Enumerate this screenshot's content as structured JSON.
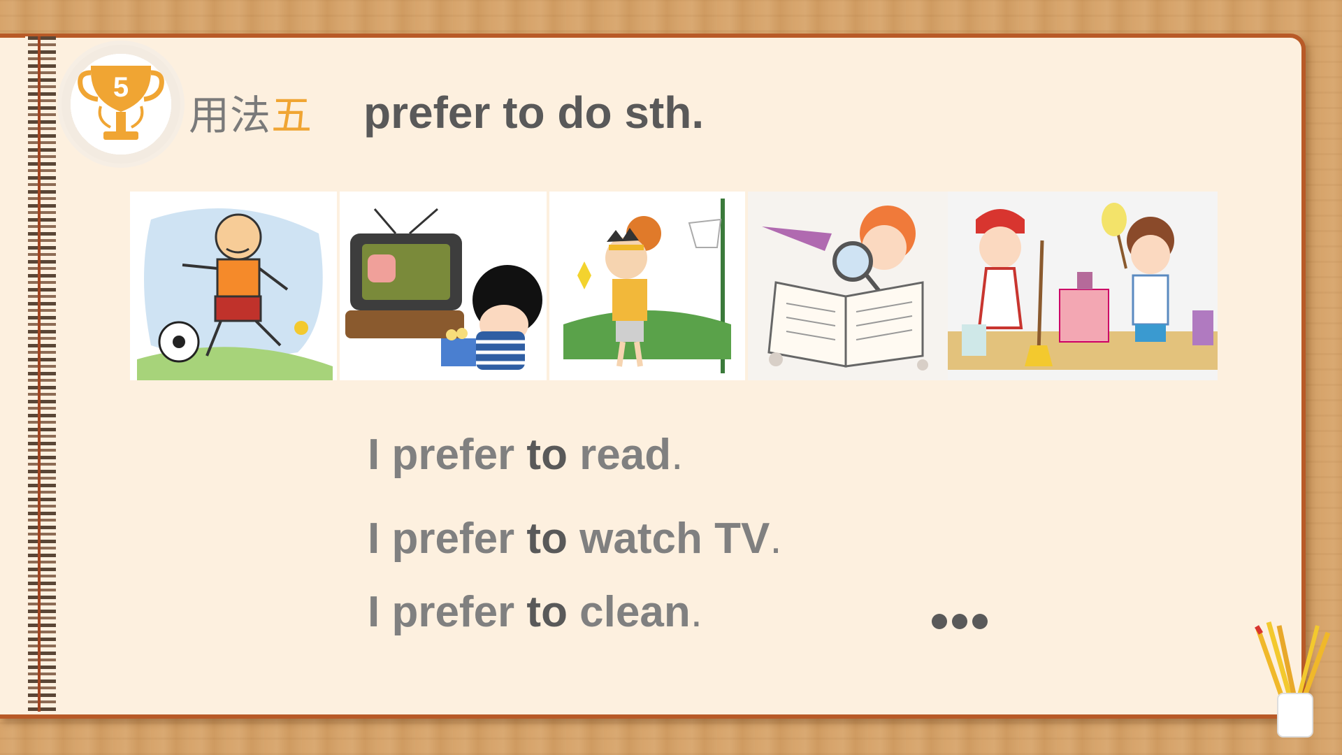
{
  "badge": {
    "number": "5"
  },
  "usage_label": {
    "prefix": "用法",
    "number": "五"
  },
  "title": "prefer to do  sth.",
  "sentences": [
    {
      "subject": "I prefer ",
      "to": "to",
      "verb": " read",
      "end": "."
    },
    {
      "subject": "I prefer ",
      "to": "to",
      "verb": " watch TV",
      "end": "."
    },
    {
      "subject": "I prefer ",
      "to": "to",
      "verb": " clean",
      "end": "."
    }
  ],
  "ellipsis": "...",
  "colors": {
    "accent_orange": "#f0a533",
    "text_dark": "#595959",
    "text_gray": "#808080",
    "page_bg": "#fdf0df",
    "border": "#b85a27"
  },
  "images": [
    {
      "icon": "boy-playing-football-illustration"
    },
    {
      "icon": "girl-watching-tv-illustration"
    },
    {
      "icon": "boy-playing-basketball-illustration"
    },
    {
      "icon": "boy-reading-book-illustration"
    },
    {
      "icon": "kids-cleaning-illustration"
    }
  ]
}
